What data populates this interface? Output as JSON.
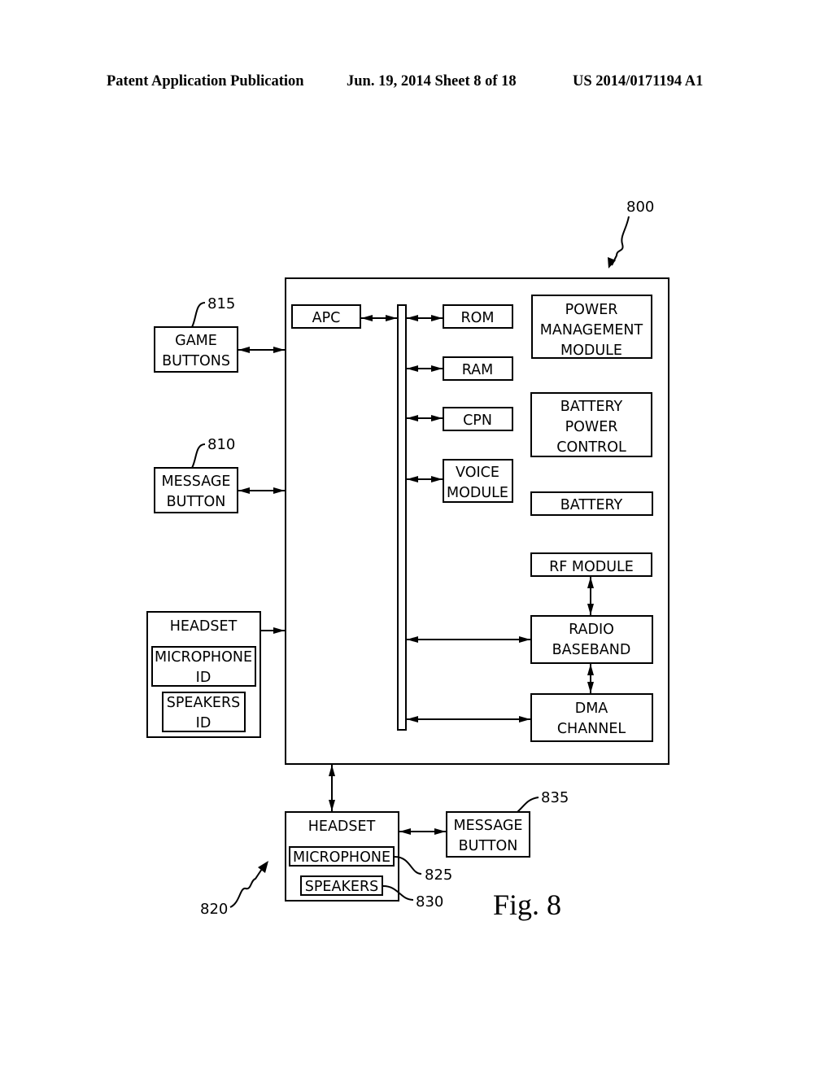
{
  "header": {
    "left": "Patent Application Publication",
    "date_sheet": "Jun. 19, 2014  Sheet 8 of 18",
    "number": "US 2014/0171194 A1"
  },
  "figure": {
    "label": "Fig. 8",
    "system_ref": "800",
    "inner_blocks": {
      "apc": "APC",
      "rom": "ROM",
      "ram": "RAM",
      "cpn": "CPN",
      "voice_module": [
        "VOICE",
        "MODULE"
      ],
      "power_management": [
        "POWER",
        "MANAGEMENT",
        "MODULE"
      ],
      "battery_power_control": [
        "BATTERY",
        "POWER",
        "CONTROL"
      ],
      "battery": "BATTERY",
      "rf_module": "RF MODULE",
      "radio_baseband": [
        "RADIO",
        "BASEBAND"
      ],
      "dma_channel": [
        "DMA",
        "CHANNEL"
      ]
    },
    "external_blocks": {
      "game_buttons": {
        "lines": [
          "GAME",
          "BUTTONS"
        ],
        "ref": "815"
      },
      "message_button_left": {
        "lines": [
          "MESSAGE",
          "BUTTON"
        ],
        "ref": "810"
      },
      "headset_left": {
        "title": "HEADSET",
        "microphone": [
          "MICROPHONE",
          "ID"
        ],
        "speakers": [
          "SPEAKERS",
          "ID"
        ]
      },
      "headset_bottom": {
        "title": "HEADSET",
        "microphone": "MICROPHONE",
        "speakers": "SPEAKERS",
        "ref": "820",
        "microphone_ref": "825",
        "speakers_ref": "830"
      },
      "message_button_bottom": {
        "lines": [
          "MESSAGE",
          "BUTTON"
        ],
        "ref": "835"
      }
    }
  }
}
